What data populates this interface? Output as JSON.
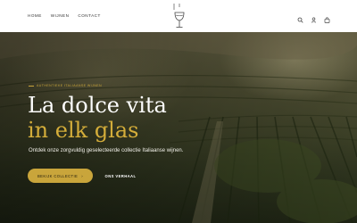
{
  "nav": {
    "items": [
      {
        "label": "HOME"
      },
      {
        "label": "WIJNEN"
      },
      {
        "label": "CONTACT"
      }
    ]
  },
  "header_icons": [
    "search-icon",
    "user-icon",
    "cart-icon"
  ],
  "hero": {
    "eyebrow": "AUTHENTIEKE ITALIAANSE WIJNEN",
    "title_line1": "La dolce vita",
    "title_line2": "in elk glas",
    "subtitle": "Ontdek onze zorgvuldig geselecteerde collectie Italiaanse wijnen.",
    "primary_button": "BEKIJK COLLECTIE",
    "primary_arrow": "›",
    "secondary_button": "ONS VERHAAL"
  },
  "colors": {
    "accent": "#c9a53b",
    "title_accent": "#d4ad3a",
    "header_bg": "#ffffff"
  }
}
